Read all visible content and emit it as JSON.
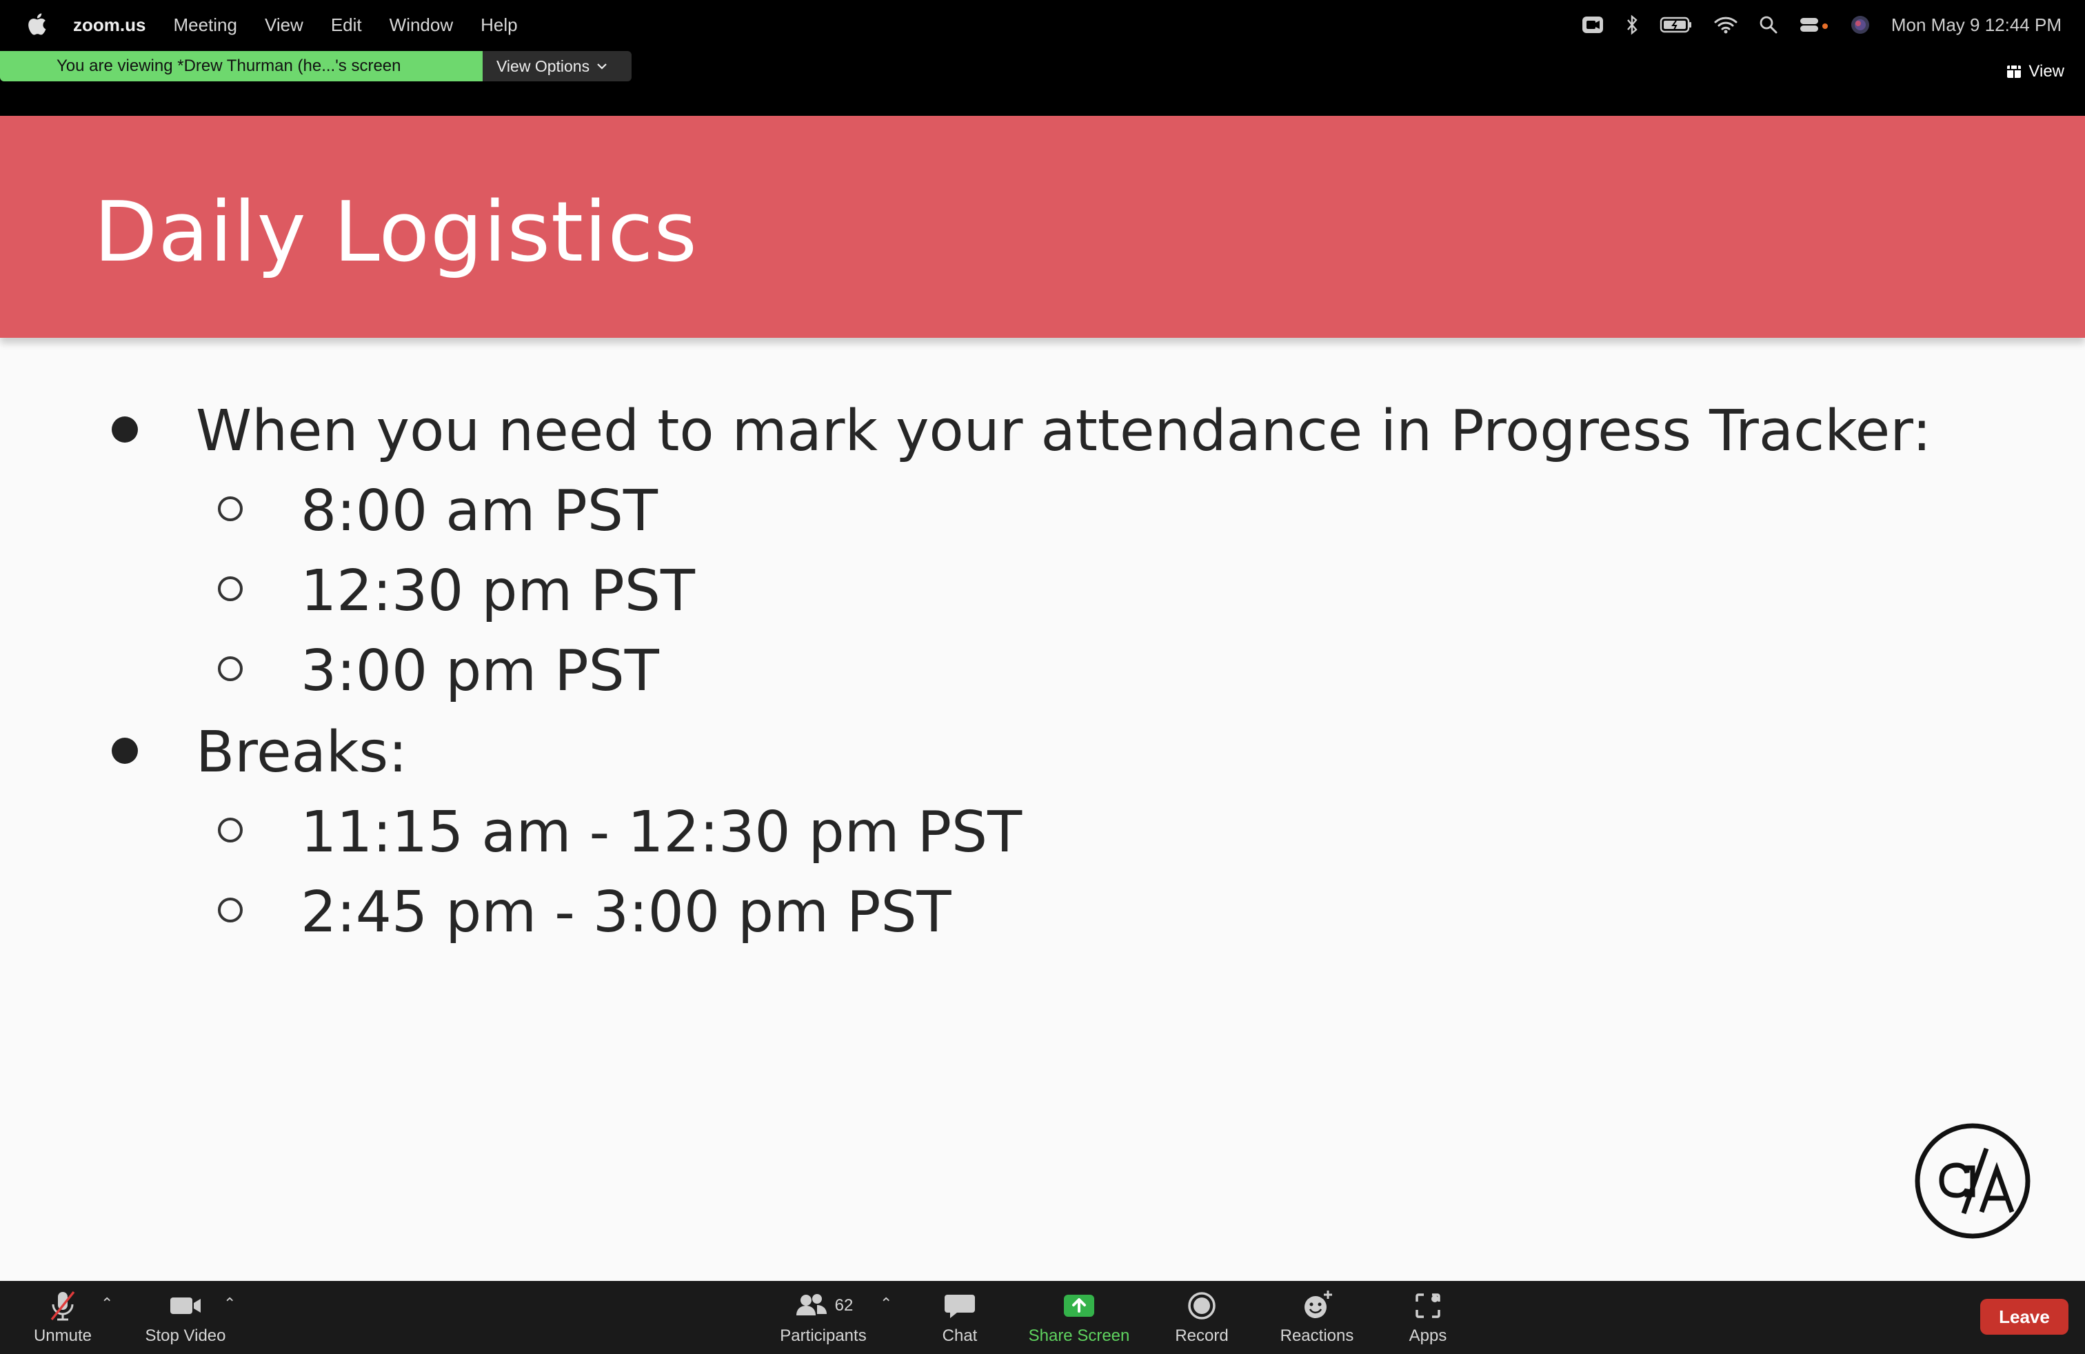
{
  "menubar": {
    "app": "zoom.us",
    "items": [
      "Meeting",
      "View",
      "Edit",
      "Window",
      "Help"
    ],
    "clock": "Mon May 9  12:44 PM"
  },
  "banner": {
    "text": "You are viewing *Drew Thurman (he...'s screen",
    "view_options": "View Options",
    "view": "View",
    "color": "#6ed86e"
  },
  "slide": {
    "title": "Daily Logistics",
    "header_color": "#dd5a61",
    "bullets": [
      {
        "text": "When you need to mark your attendance in Progress Tracker:",
        "sub": [
          "8:00 am PST",
          "12:30 pm PST",
          "3:00 pm PST"
        ]
      },
      {
        "text": "Breaks:",
        "sub": [
          "11:15 am - 12:30 pm PST",
          "2:45 pm - 3:00 pm PST"
        ]
      }
    ]
  },
  "toolbar": {
    "unmute": "Unmute",
    "stop_video": "Stop Video",
    "participants": "Participants",
    "participants_count": "62",
    "chat": "Chat",
    "share_screen": "Share Screen",
    "record": "Record",
    "reactions": "Reactions",
    "apps": "Apps",
    "leave": "Leave",
    "leave_color": "#c7332b",
    "share_color": "#5fd35f"
  }
}
